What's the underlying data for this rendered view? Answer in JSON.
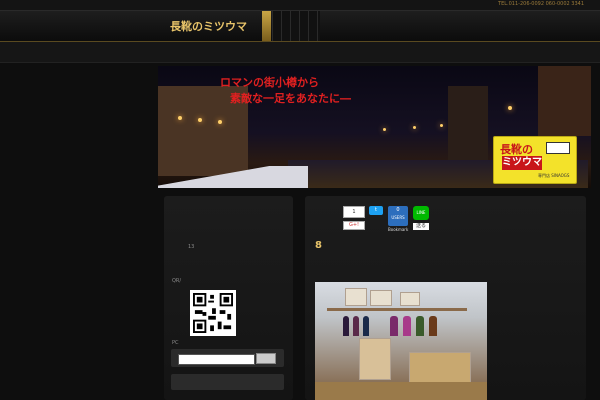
{
  "topbar": {
    "tel": "TEL.011-206-0092 060-0002 3341"
  },
  "header": {
    "site_title": "長靴のミツウマ"
  },
  "banner": {
    "catch_line1": "ロマンの街小樽から",
    "catch_line2": "素敵な一足をあなたに―",
    "logo_top": "長靴の",
    "logo_main": "ミツウマ",
    "logo_sub": "専門店 SINAOGS"
  },
  "sidebar": {
    "count": "13",
    "qr_label": "QR/",
    "pc_label": "PC",
    "search": {
      "value": "",
      "button_label": ""
    }
  },
  "share": {
    "gplus_count": "1",
    "gplus_label": "G+!",
    "twitter_label": "t",
    "hatena_count": "0",
    "hatena_label": "USERS",
    "hatena_sub": "Bookmark",
    "line_label": "LINE",
    "line_sub": "送る"
  },
  "post": {
    "title": "8"
  },
  "colors": {
    "accent_gold": "#e8c46a",
    "background": "#0e0e0e",
    "catch_red": "#e02020"
  }
}
